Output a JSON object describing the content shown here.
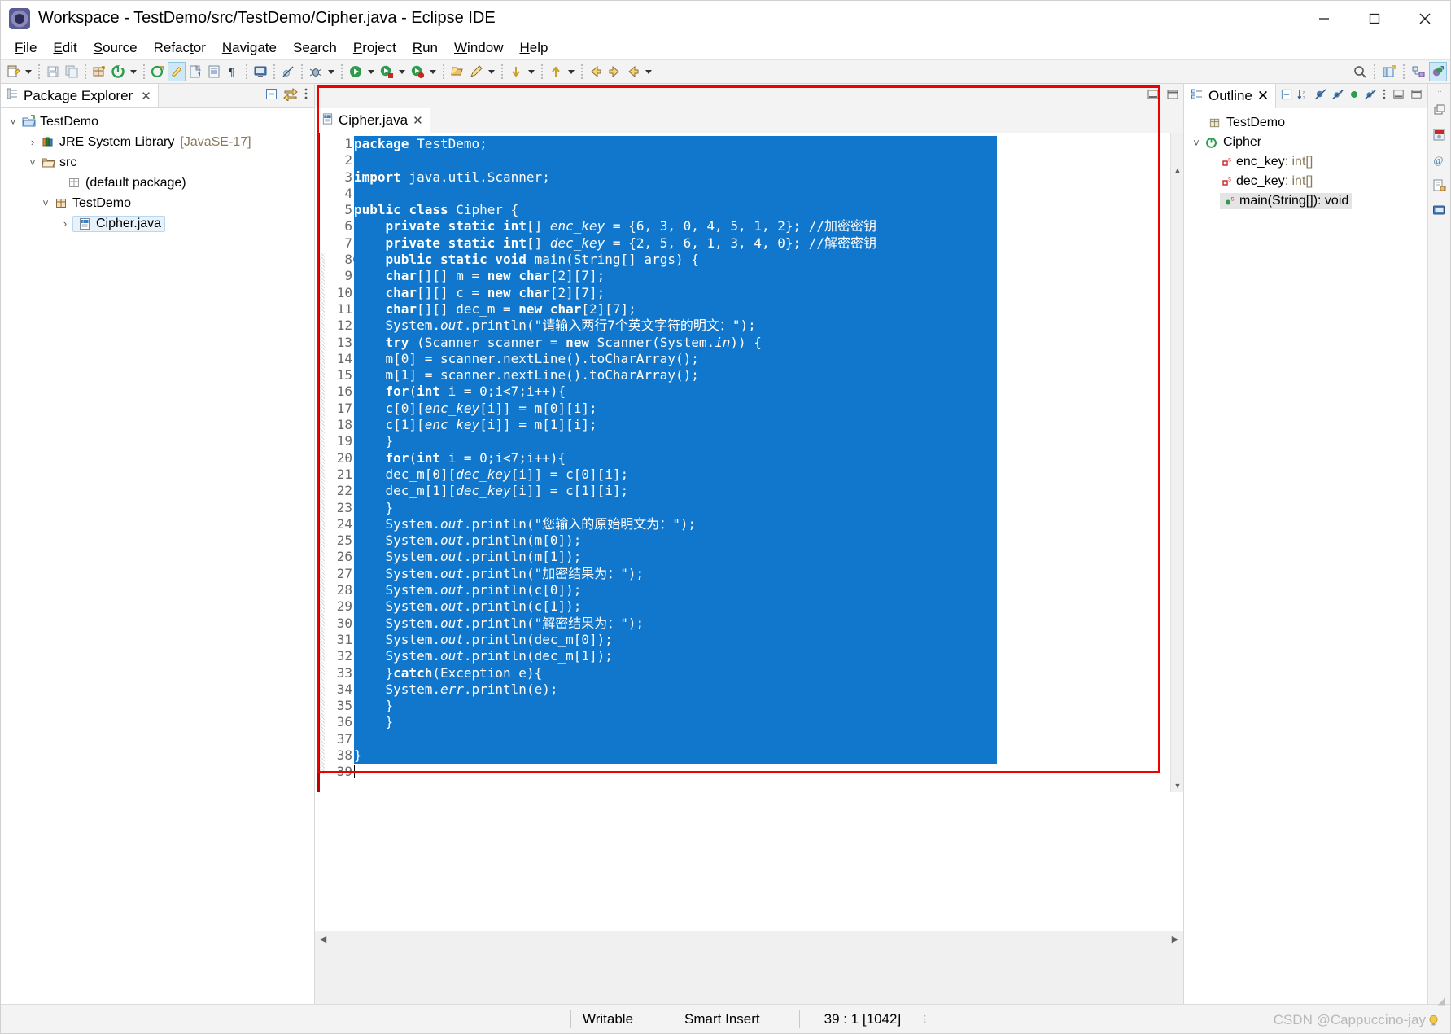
{
  "window": {
    "title": "Workspace - TestDemo/src/TestDemo/Cipher.java - Eclipse IDE",
    "logo_icon": "eclipse-logo-icon",
    "minimize_icon": "minimize-icon",
    "maximize_icon": "maximize-icon",
    "close_icon": "close-icon"
  },
  "menubar": {
    "items": [
      {
        "label": "File",
        "mnemonic": "F"
      },
      {
        "label": "Edit",
        "mnemonic": "E"
      },
      {
        "label": "Source",
        "mnemonic": "S"
      },
      {
        "label": "Refactor",
        "mnemonic": "t"
      },
      {
        "label": "Navigate",
        "mnemonic": "N"
      },
      {
        "label": "Search",
        "mnemonic": "a"
      },
      {
        "label": "Project",
        "mnemonic": "P"
      },
      {
        "label": "Run",
        "mnemonic": "R"
      },
      {
        "label": "Window",
        "mnemonic": "W"
      },
      {
        "label": "Help",
        "mnemonic": "H"
      }
    ]
  },
  "toolbar": {
    "icons": [
      "new-wizard-icon",
      "save-icon",
      "save-all-icon",
      "new-java-package-icon",
      "external-tools-icon",
      "new-java-project-icon",
      "toggle-mark-occurrences-icon",
      "open-task-icon",
      "toggle-block-selection-icon",
      "show-whitespace-icon",
      "open-console-icon",
      "skip-breakpoints-icon",
      "debug-icon",
      "run-icon",
      "run-coverage-icon",
      "run-configuration-icon",
      "open-type-icon",
      "search-icon",
      "next-annotation-icon",
      "previous-annotation-icon",
      "back-icon",
      "forward-icon",
      "last-edit-location-icon"
    ],
    "right_icons": [
      "quick-access-search-icon",
      "open-perspective-icon",
      "java-ee-perspective-icon",
      "java-perspective-icon"
    ]
  },
  "package_explorer": {
    "tab_label": "Package Explorer",
    "tab_icon": "package-explorer-icon",
    "close_icon": "close-icon",
    "tools": [
      "collapse-all-icon",
      "link-with-editor-icon",
      "view-menu-icon"
    ],
    "tree": [
      {
        "label": "TestDemo",
        "icon": "java-project-icon",
        "twist": "expanded",
        "indent": 0,
        "suffix": ""
      },
      {
        "label": "JRE System Library",
        "icon": "library-icon",
        "twist": "collapsed",
        "indent": 1,
        "suffix": "[JavaSE-17]"
      },
      {
        "label": "src",
        "icon": "source-folder-icon",
        "twist": "expanded",
        "indent": 1,
        "suffix": ""
      },
      {
        "label": "(default package)",
        "icon": "package-icon",
        "twist": "none",
        "indent": 2,
        "suffix": ""
      },
      {
        "label": "TestDemo",
        "icon": "package-icon",
        "twist": "expanded",
        "indent": 2,
        "suffix": ""
      },
      {
        "label": "Cipher.java",
        "icon": "java-file-icon",
        "twist": "collapsed",
        "indent": 3,
        "suffix": "",
        "selected": true
      }
    ]
  },
  "editor": {
    "tab_label": "Cipher.java",
    "tab_icon": "java-file-icon",
    "close_icon": "close-icon",
    "minimize_icon": "minimize-icon",
    "maximize_icon": "maximize-icon",
    "selection_color": "#1177cc",
    "highlight_border_color": "#ee0000",
    "total_lines": 39,
    "fold_marker_line": 8,
    "lines": [
      {
        "n": 1,
        "text": "package TestDemo;"
      },
      {
        "n": 2,
        "text": ""
      },
      {
        "n": 3,
        "text": "import java.util.Scanner;"
      },
      {
        "n": 4,
        "text": ""
      },
      {
        "n": 5,
        "text": "public class Cipher {"
      },
      {
        "n": 6,
        "text": "    private static int[] enc_key = {6, 3, 0, 4, 5, 1, 2}; //加密密钥"
      },
      {
        "n": 7,
        "text": "    private static int[] dec_key = {2, 5, 6, 1, 3, 4, 0}; //解密密钥"
      },
      {
        "n": 8,
        "text": "    public static void main(String[] args) {"
      },
      {
        "n": 9,
        "text": "    char[][] m = new char[2][7];"
      },
      {
        "n": 10,
        "text": "    char[][] c = new char[2][7];"
      },
      {
        "n": 11,
        "text": "    char[][] dec_m = new char[2][7];"
      },
      {
        "n": 12,
        "text": "    System.out.println(\"请输入两行7个英文字符的明文：\");"
      },
      {
        "n": 13,
        "text": "    try (Scanner scanner = new Scanner(System.in)) {"
      },
      {
        "n": 14,
        "text": "    m[0] = scanner.nextLine().toCharArray();"
      },
      {
        "n": 15,
        "text": "    m[1] = scanner.nextLine().toCharArray();"
      },
      {
        "n": 16,
        "text": "    for(int i = 0;i<7;i++){"
      },
      {
        "n": 17,
        "text": "    c[0][enc_key[i]] = m[0][i];"
      },
      {
        "n": 18,
        "text": "    c[1][enc_key[i]] = m[1][i];"
      },
      {
        "n": 19,
        "text": "    }"
      },
      {
        "n": 20,
        "text": "    for(int i = 0;i<7;i++){"
      },
      {
        "n": 21,
        "text": "    dec_m[0][dec_key[i]] = c[0][i];"
      },
      {
        "n": 22,
        "text": "    dec_m[1][dec_key[i]] = c[1][i];"
      },
      {
        "n": 23,
        "text": "    }"
      },
      {
        "n": 24,
        "text": "    System.out.println(\"您输入的原始明文为：\");"
      },
      {
        "n": 25,
        "text": "    System.out.println(m[0]);"
      },
      {
        "n": 26,
        "text": "    System.out.println(m[1]);"
      },
      {
        "n": 27,
        "text": "    System.out.println(\"加密结果为：\");"
      },
      {
        "n": 28,
        "text": "    System.out.println(c[0]);"
      },
      {
        "n": 29,
        "text": "    System.out.println(c[1]);"
      },
      {
        "n": 30,
        "text": "    System.out.println(\"解密结果为：\");"
      },
      {
        "n": 31,
        "text": "    System.out.println(dec_m[0]);"
      },
      {
        "n": 32,
        "text": "    System.out.println(dec_m[1]);"
      },
      {
        "n": 33,
        "text": "    }catch(Exception e){"
      },
      {
        "n": 34,
        "text": "    System.err.println(e);"
      },
      {
        "n": 35,
        "text": "    }"
      },
      {
        "n": 36,
        "text": "    }"
      },
      {
        "n": 37,
        "text": ""
      },
      {
        "n": 38,
        "text": "}"
      },
      {
        "n": 39,
        "text": ""
      }
    ]
  },
  "outline": {
    "tab_label": "Outline",
    "tab_icon": "outline-icon",
    "close_icon": "close-icon",
    "tools": [
      "collapse-all-icon",
      "sort-icon",
      "hide-fields-icon",
      "hide-static-icon",
      "hide-non-public-icon",
      "hide-local-types-icon",
      "view-menu-icon",
      "minimize-icon",
      "maximize-icon"
    ],
    "items": [
      {
        "label": "TestDemo",
        "icon": "package-icon",
        "twist": "none",
        "indent": 1,
        "type": ""
      },
      {
        "label": "Cipher",
        "icon": "class-icon",
        "twist": "expanded",
        "indent": 0,
        "type": ""
      },
      {
        "label": "enc_key",
        "icon": "private-field-icon",
        "twist": "none",
        "indent": 2,
        "type": " : int[]",
        "static": "S"
      },
      {
        "label": "dec_key",
        "icon": "private-field-icon",
        "twist": "none",
        "indent": 2,
        "type": " : int[]",
        "static": "S"
      },
      {
        "label": "main(String[])",
        "icon": "public-method-icon",
        "twist": "none",
        "indent": 2,
        "type": " : void",
        "static": "S",
        "highlighted": true
      }
    ]
  },
  "rail": {
    "icons": [
      "restore-icon",
      "java-browsing-icon",
      "at-icon",
      "java-editor-icon",
      "console-icon"
    ]
  },
  "statusbar": {
    "writable": "Writable",
    "insert_mode": "Smart Insert",
    "position": "39 : 1 [1042]",
    "watermark": "CSDN @Cappuccino-jay",
    "bulb_icon": "quick-fix-bulb-icon"
  }
}
